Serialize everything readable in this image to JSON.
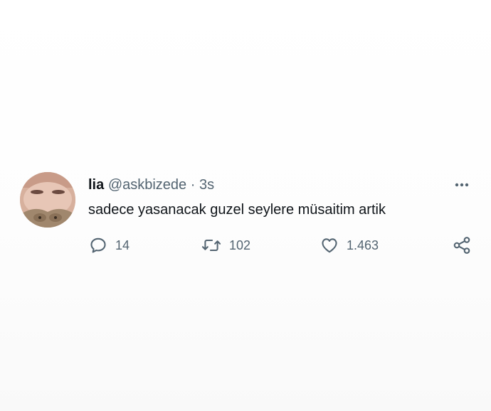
{
  "tweet": {
    "author": {
      "name": "lia",
      "handle": "@askbizede",
      "separator": "·",
      "time": "3s"
    },
    "text": "sadece yasanacak guzel seylere müsaitim artik",
    "actions": {
      "reply_count": "14",
      "retweet_count": "102",
      "like_count": "1.463"
    },
    "icons": {
      "more": "more-dots-icon",
      "reply": "reply-bubble-icon",
      "retweet": "retweet-icon",
      "like": "heart-icon",
      "share": "share-icon"
    },
    "colors": {
      "text": "#0f1419",
      "muted": "#536471"
    }
  }
}
